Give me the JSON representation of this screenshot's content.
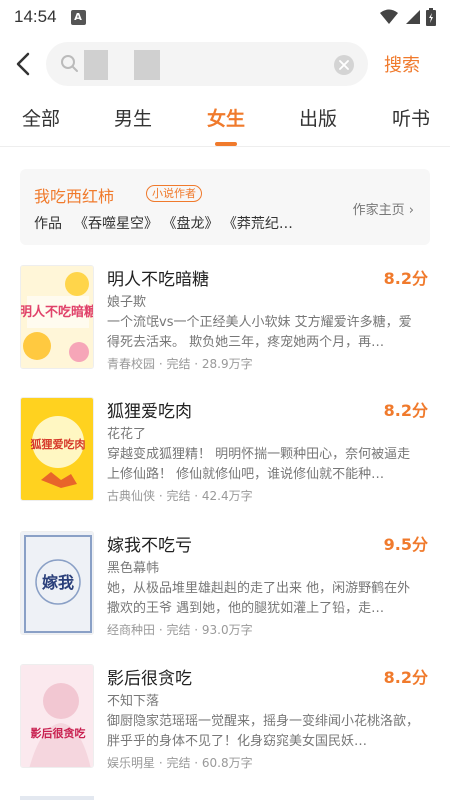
{
  "status": {
    "time": "14:54",
    "badge": "A"
  },
  "search": {
    "submit_label": "搜索"
  },
  "tabs": [
    {
      "label": "全部"
    },
    {
      "label": "男生"
    },
    {
      "label": "女生"
    },
    {
      "label": "出版"
    },
    {
      "label": "听书"
    }
  ],
  "active_tab_index": 2,
  "author": {
    "name": "我吃西红柿",
    "badge": "小说作者",
    "works_label": "作品",
    "works": "《吞噬星空》 《盘龙》 《莽荒纪…",
    "link": "作家主页 ›"
  },
  "books": [
    {
      "title": "明人不吃暗糖",
      "score": "8.2分",
      "author": "娘子欺",
      "desc": "一个流氓vs一个正经美人小软妹 艾方耀爱许多糖，爱得死去活来。 欺负她三年，疼宠她两个月，再…",
      "meta": "青春校园 · 完结 · 28.9万字",
      "cover_text": "明人不吃暗糖"
    },
    {
      "title": "狐狸爱吃肉",
      "score": "8.2分",
      "author": "花花了",
      "desc": "穿越变成狐狸精！ 明明怀揣一颗种田心，奈何被逼走上修仙路！ 修仙就修仙吧，谁说修仙就不能种…",
      "meta": "古典仙侠 · 完结 · 42.4万字",
      "cover_text": "狐狸爱吃肉"
    },
    {
      "title": "嫁我不吃亏",
      "score": "9.5分",
      "author": "黑色幕帏",
      "desc": "她，从极品堆里雄赳赳的走了出来 他，闲游野鹤在外撒欢的王爷 遇到她，他的腿犹如灌上了铅，走…",
      "meta": "经商种田 · 完结 · 93.0万字",
      "cover_text": "嫁我"
    },
    {
      "title": "影后很贪吃",
      "score": "8.2分",
      "author": "不知下落",
      "desc": "御厨隐家范瑶瑶一觉醒来，摇身一变绯闻小花桃洛歆，胖乎乎的身体不见了！化身窈窕美女国民妖…",
      "meta": "娱乐明星 · 完结 · 60.8万字",
      "cover_text": "影后很贪吃"
    }
  ],
  "colors": {
    "accent": "#f07a2c",
    "muted": "#777777"
  }
}
